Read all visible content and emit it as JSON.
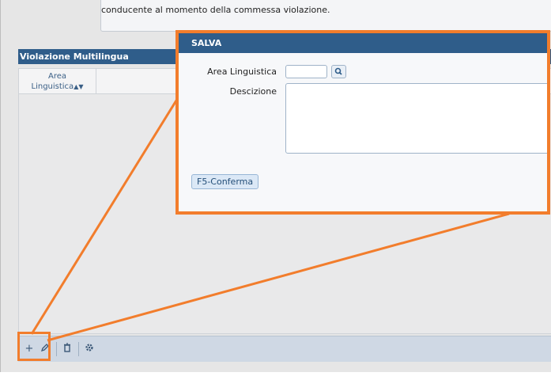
{
  "background_form": {
    "description_text": "conducente  al momento della commessa violazione."
  },
  "panel": {
    "title": "Violazione Multilingua",
    "column_header": "Area\nLinguistica"
  },
  "toolbar": {
    "add_label": "+",
    "edit_icon": "pencil-icon",
    "delete_icon": "trash-icon",
    "settings_icon": "gear-icon"
  },
  "dialog": {
    "title": "SALVA",
    "area_label": "Area Linguistica",
    "desc_label": "Descizione",
    "confirm_label": "F5-Conferma"
  },
  "colors": {
    "header_blue": "#2f5d8a",
    "highlight_orange": "#f27d2c"
  }
}
